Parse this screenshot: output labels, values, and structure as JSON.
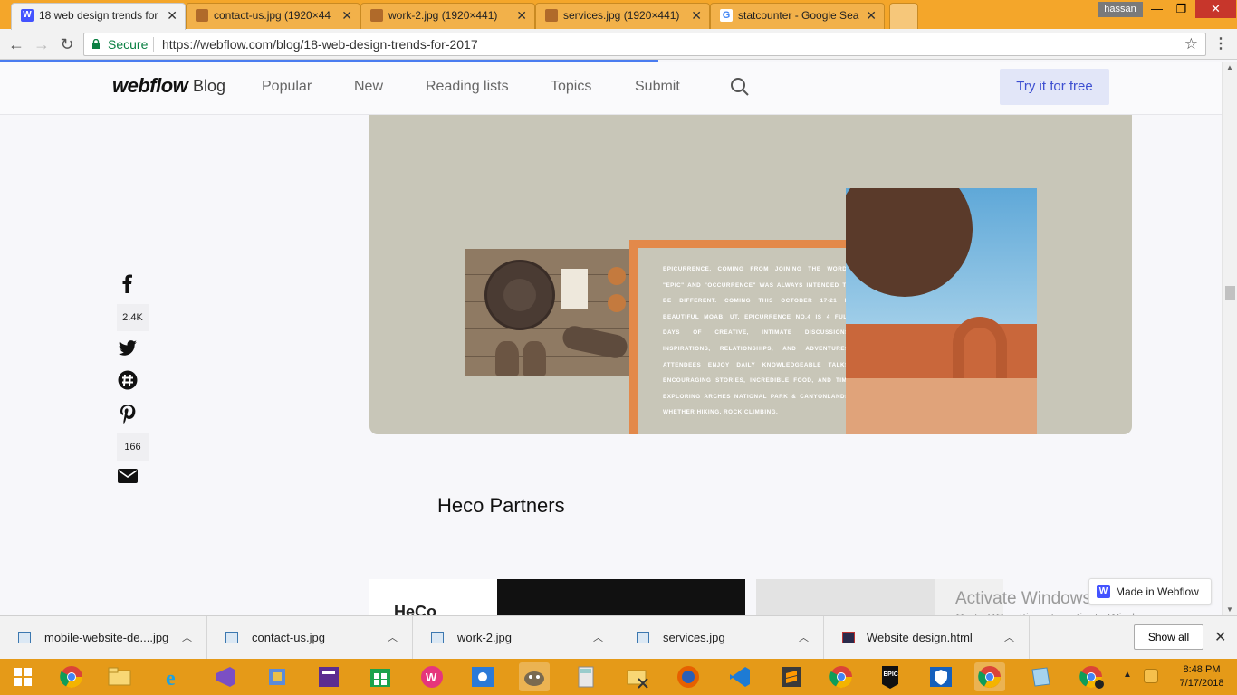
{
  "browser": {
    "tabs": [
      {
        "title": "18 web design trends for",
        "icon_color": "#4353ff",
        "active": true
      },
      {
        "title": "contact-us.jpg (1920×44",
        "icon_color": "#b06a2a",
        "active": false
      },
      {
        "title": "work-2.jpg (1920×441)",
        "icon_color": "#b06a2a",
        "active": false
      },
      {
        "title": "services.jpg (1920×441)",
        "icon_color": "#b06a2a",
        "active": false
      },
      {
        "title": "statcounter - Google Sea",
        "icon_color": "#4285f4",
        "active": false
      }
    ],
    "tab_close_glyph": "✕",
    "user": "hassan",
    "address": {
      "secure_label": "Secure",
      "url": "https://webflow.com/blog/18-web-design-trends-for-2017"
    }
  },
  "site": {
    "logo": "webflow",
    "blog_label": "Blog",
    "nav": [
      "Popular",
      "New",
      "Reading lists",
      "Topics",
      "Submit"
    ],
    "cta": "Try it for free"
  },
  "article": {
    "image_text": "Epicurrence, coming from joining the words \"epic\" and \"occurrence\" was always intended to be different. Coming this October 17-21 in beautiful Moab, UT, Epicurrence No.4 is 4 full days of creative, intimate discussions, inspirations, relationships, and adventures. Attendees enjoy daily knowledgeable talks, encouraging stories, incredible food, and time exploring Arches National Park & Canyonlands. Whether hiking, rock climbing,",
    "section_title": "Heco Partners",
    "card_logo": "HeCo"
  },
  "share": {
    "facebook_count": "2.4K",
    "pinterest_count": "166"
  },
  "badge": {
    "made_in": "Made in Webflow"
  },
  "watermark": {
    "title": "Activate Windows",
    "subtitle": "Go to PC settings to activate Windows."
  },
  "downloads": {
    "items": [
      "mobile-website-de....jpg",
      "contact-us.jpg",
      "work-2.jpg",
      "services.jpg",
      "Website design.html"
    ],
    "show_all": "Show all"
  },
  "taskbar": {
    "time": "8:48 PM",
    "date": "7/17/2018",
    "apps": [
      "windows-start",
      "chrome",
      "file-explorer",
      "internet-explorer",
      "visual-studio",
      "app",
      "calculator-app",
      "store",
      "wamp",
      "brightness",
      "gimp",
      "calculator",
      "folder-sync",
      "firefox",
      "vscode",
      "sublime",
      "chrome",
      "epic-games",
      "mcafee",
      "chrome-active",
      "notepad",
      "chrome-user"
    ]
  },
  "colors": {
    "accent": "#4353ff",
    "cta_text": "#3d4fd1",
    "frame_orange": "#e3894a",
    "taskbar": "#e59a18"
  }
}
